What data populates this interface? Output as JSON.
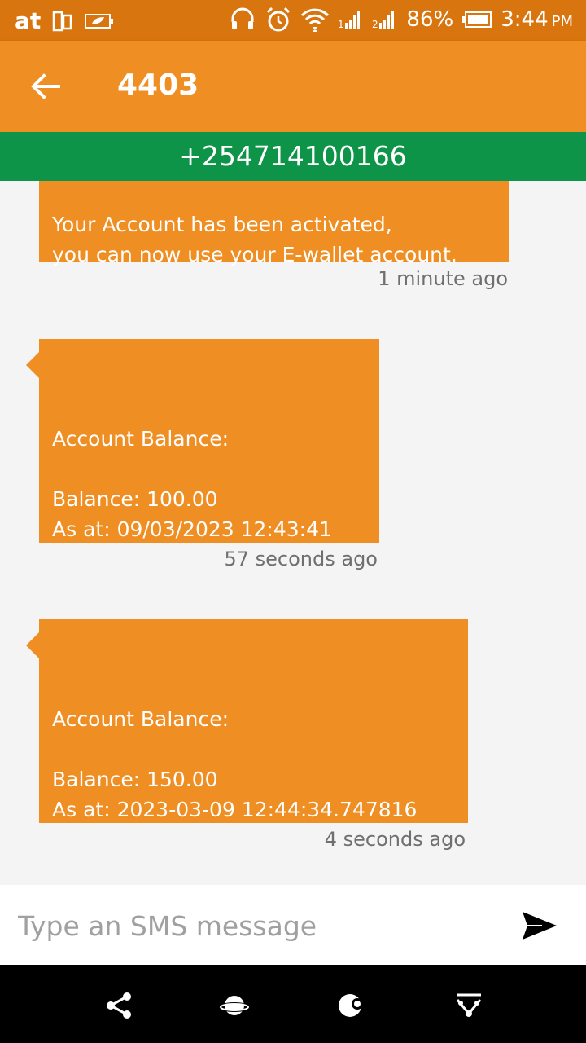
{
  "status_bar": {
    "carrier_logo": "at",
    "battery_percent": "86%",
    "time": "3:44",
    "ampm": "PM",
    "icons": [
      "carrier-logo-icon",
      "dual-sim-icon",
      "battery-saver-icon",
      "headset-icon",
      "alarm-icon",
      "wifi-icon",
      "signal-sim1-icon",
      "signal-sim2-icon",
      "battery-icon"
    ]
  },
  "header": {
    "title": "4403",
    "back_icon": "arrow-back-icon"
  },
  "contact": {
    "number": "+254714100166"
  },
  "messages": [
    {
      "text": "Your Account has been activated,\n you can now use your E-wallet account.",
      "time": "1 minute ago"
    },
    {
      "text": "Account Balance:\n\nBalance: 100.00\nAs at: 09/03/2023 12:43:41",
      "time": "57 seconds ago"
    },
    {
      "text": "Account Balance:\n\nBalance: 150.00\nAs at: 2023-03-09 12:44:34.747816",
      "time": "4 seconds ago"
    }
  ],
  "composer": {
    "placeholder": "Type an SMS message",
    "send_icon": "send-icon"
  },
  "nav_bar": {
    "icons": [
      "share-nodes-icon",
      "planet-icon",
      "moon-icon",
      "download-icon"
    ]
  },
  "colors": {
    "status_bar": "#d9750f",
    "app_bar": "#ef8e22",
    "number_bar": "#0e9448",
    "bubble": "#ef8e22",
    "background": "#f4f4f4"
  }
}
